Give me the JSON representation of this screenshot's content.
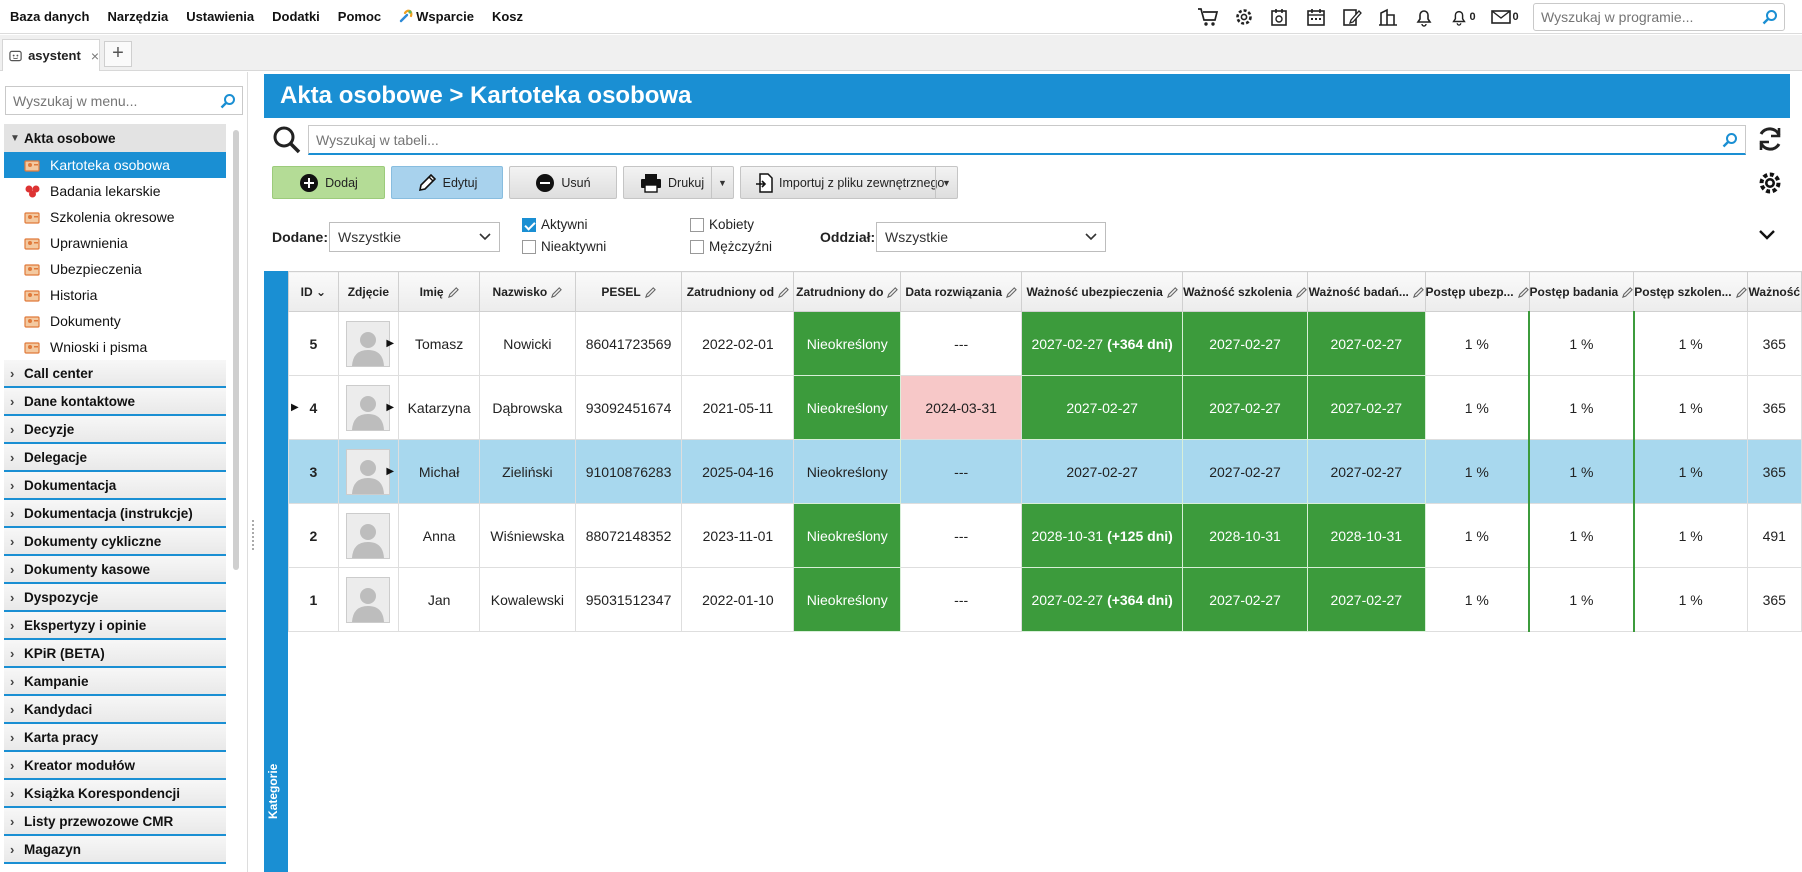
{
  "menu": [
    "Baza danych",
    "Narzędzia",
    "Ustawienia",
    "Dodatki",
    "Pomoc",
    "Wsparcie",
    "Kosz"
  ],
  "top_icons": [
    {
      "name": "cart-icon"
    },
    {
      "name": "settings-gear-icon"
    },
    {
      "name": "calendar-clock-icon"
    },
    {
      "name": "calendar-icon"
    },
    {
      "name": "edit-note-icon"
    },
    {
      "name": "building-icon"
    },
    {
      "name": "bell-icon"
    },
    {
      "name": "bell-count-icon",
      "count": "0"
    },
    {
      "name": "mail-icon",
      "count": "0"
    }
  ],
  "top_search": {
    "placeholder": "Wyszukaj w programie..."
  },
  "tab": {
    "label": "asystent",
    "close": "×",
    "add": "+"
  },
  "sidebar": {
    "search_placeholder": "Wyszukaj w menu...",
    "open_group": "Akta osobowe",
    "sub_items": [
      {
        "label": "Kartoteka osobowa",
        "active": true
      },
      {
        "label": "Badania lekarskie"
      },
      {
        "label": "Szkolenia okresowe"
      },
      {
        "label": "Uprawnienia"
      },
      {
        "label": "Ubezpieczenia"
      },
      {
        "label": "Historia"
      },
      {
        "label": "Dokumenty"
      },
      {
        "label": "Wnioski i pisma"
      }
    ],
    "groups": [
      "Call center",
      "Dane kontaktowe",
      "Decyzje",
      "Delegacje",
      "Dokumentacja",
      "Dokumentacja (instrukcje)",
      "Dokumenty cykliczne",
      "Dokumenty kasowe",
      "Dyspozycje",
      "Ekspertyzy i opinie",
      "KPiR (BETA)",
      "Kampanie",
      "Kandydaci",
      "Karta pracy",
      "Kreator modułów",
      "Książka Korespondencji",
      "Listy przewozowe CMR",
      "Magazyn"
    ]
  },
  "page": {
    "title": "Akta osobowe > Kartoteka osobowa",
    "table_search_placeholder": "Wyszukaj w tabeli..."
  },
  "toolbar": {
    "add": "Dodaj",
    "edit": "Edytuj",
    "delete": "Usuń",
    "print": "Drukuj",
    "import": "Importuj z pliku zewnętrznego"
  },
  "filters": {
    "added_label": "Dodane:",
    "added_value": "Wszystkie",
    "active_label": "Aktywni",
    "active_checked": true,
    "inactive_label": "Nieaktywni",
    "women_label": "Kobiety",
    "men_label": "Mężczyźni",
    "branch_label": "Oddział:",
    "branch_value": "Wszystkie"
  },
  "categories_label": "Kategorie",
  "columns": [
    "ID",
    "Zdjęcie",
    "Imię",
    "Nazwisko",
    "PESEL",
    "Zatrudniony od",
    "Zatrudniony do",
    "Data rozwiązania",
    "Ważność ubezpieczenia",
    "Ważność szkolenia",
    "Ważność badań...",
    "Postęp ubezp...",
    "Postęp badania",
    "Postęp szkolen...",
    "Ważność"
  ],
  "rows": [
    {
      "id": "5",
      "first": "Tomasz",
      "last": "Nowicki",
      "pesel": "86041723569",
      "from": "2022-02-01",
      "to": "Nieokreślony",
      "term": "---",
      "ins": "2027-02-27",
      "ins_extra": "(+364 dni)",
      "train": "2027-02-27",
      "med": "2027-02-27",
      "p1": "1 %",
      "p2": "1 %",
      "p3": "1 %",
      "last_col": "365"
    },
    {
      "id": "4",
      "first": "Katarzyna",
      "last": "Dąbrowska",
      "pesel": "93092451674",
      "from": "2021-05-11",
      "to": "Nieokreślony",
      "term": "2024-03-31",
      "ins": "2027-02-27",
      "ins_extra": "",
      "train": "2027-02-27",
      "med": "2027-02-27",
      "p1": "1 %",
      "p2": "1 %",
      "p3": "1 %",
      "last_col": "365"
    },
    {
      "id": "3",
      "first": "Michał",
      "last": "Zieliński",
      "pesel": "91010876283",
      "from": "2025-04-16",
      "to": "Nieokreślony",
      "term": "---",
      "ins": "2027-02-27",
      "ins_extra": "",
      "train": "2027-02-27",
      "med": "2027-02-27",
      "p1": "1 %",
      "p2": "1 %",
      "p3": "1 %",
      "last_col": "365"
    },
    {
      "id": "2",
      "first": "Anna",
      "last": "Wiśniewska",
      "pesel": "88072148352",
      "from": "2023-11-01",
      "to": "Nieokreślony",
      "term": "---",
      "ins": "2028-10-31",
      "ins_extra": "(+125 dni)",
      "train": "2028-10-31",
      "med": "2028-10-31",
      "p1": "1 %",
      "p2": "1 %",
      "p3": "1 %",
      "last_col": "491"
    },
    {
      "id": "1",
      "first": "Jan",
      "last": "Kowalewski",
      "pesel": "95031512347",
      "from": "2022-01-10",
      "to": "Nieokreślony",
      "term": "---",
      "ins": "2027-02-27",
      "ins_extra": "(+364 dni)",
      "train": "2027-02-27",
      "med": "2027-02-27",
      "p1": "1 %",
      "p2": "1 %",
      "p3": "1 %",
      "last_col": "365"
    }
  ],
  "colors": {
    "accent": "#1a8fd3",
    "valid_green": "#3c9b3c",
    "terminated_pink": "#f7c8c8",
    "selected_row": "#a8d8ee"
  }
}
